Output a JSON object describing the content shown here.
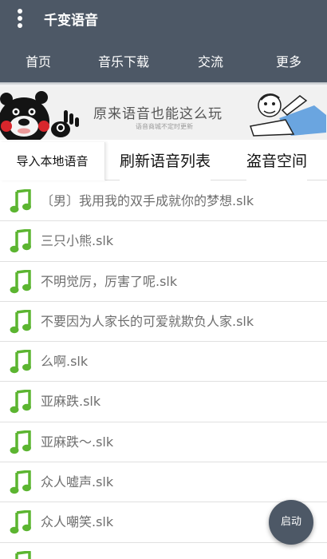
{
  "app": {
    "title": "千变语音"
  },
  "nav": {
    "items": [
      "首页",
      "音乐下载",
      "交流",
      "更多"
    ]
  },
  "banner": {
    "text": "原来语音也能这么玩",
    "subtext": "语音商城不定时更新"
  },
  "actions": {
    "import": "导入本地语音",
    "refresh": "刷新语音列表",
    "steal": "盗音空间"
  },
  "files": [
    "〔男〕我用我的双手成就你的梦想.slk",
    "三只小熊.slk",
    "不明觉厉，厉害了呢.slk",
    "不要因为人家长的可爱就欺负人家.slk",
    "么啊.slk",
    "亚麻跌.slk",
    "亚麻跌～.slk",
    "众人嘘声.slk",
    "众人嘲笑.slk"
  ],
  "fab": {
    "label": "启动"
  },
  "colors": {
    "appbar": "#4d5866",
    "note_icon": "#5cb531",
    "list_text": "#6e6e6e"
  }
}
